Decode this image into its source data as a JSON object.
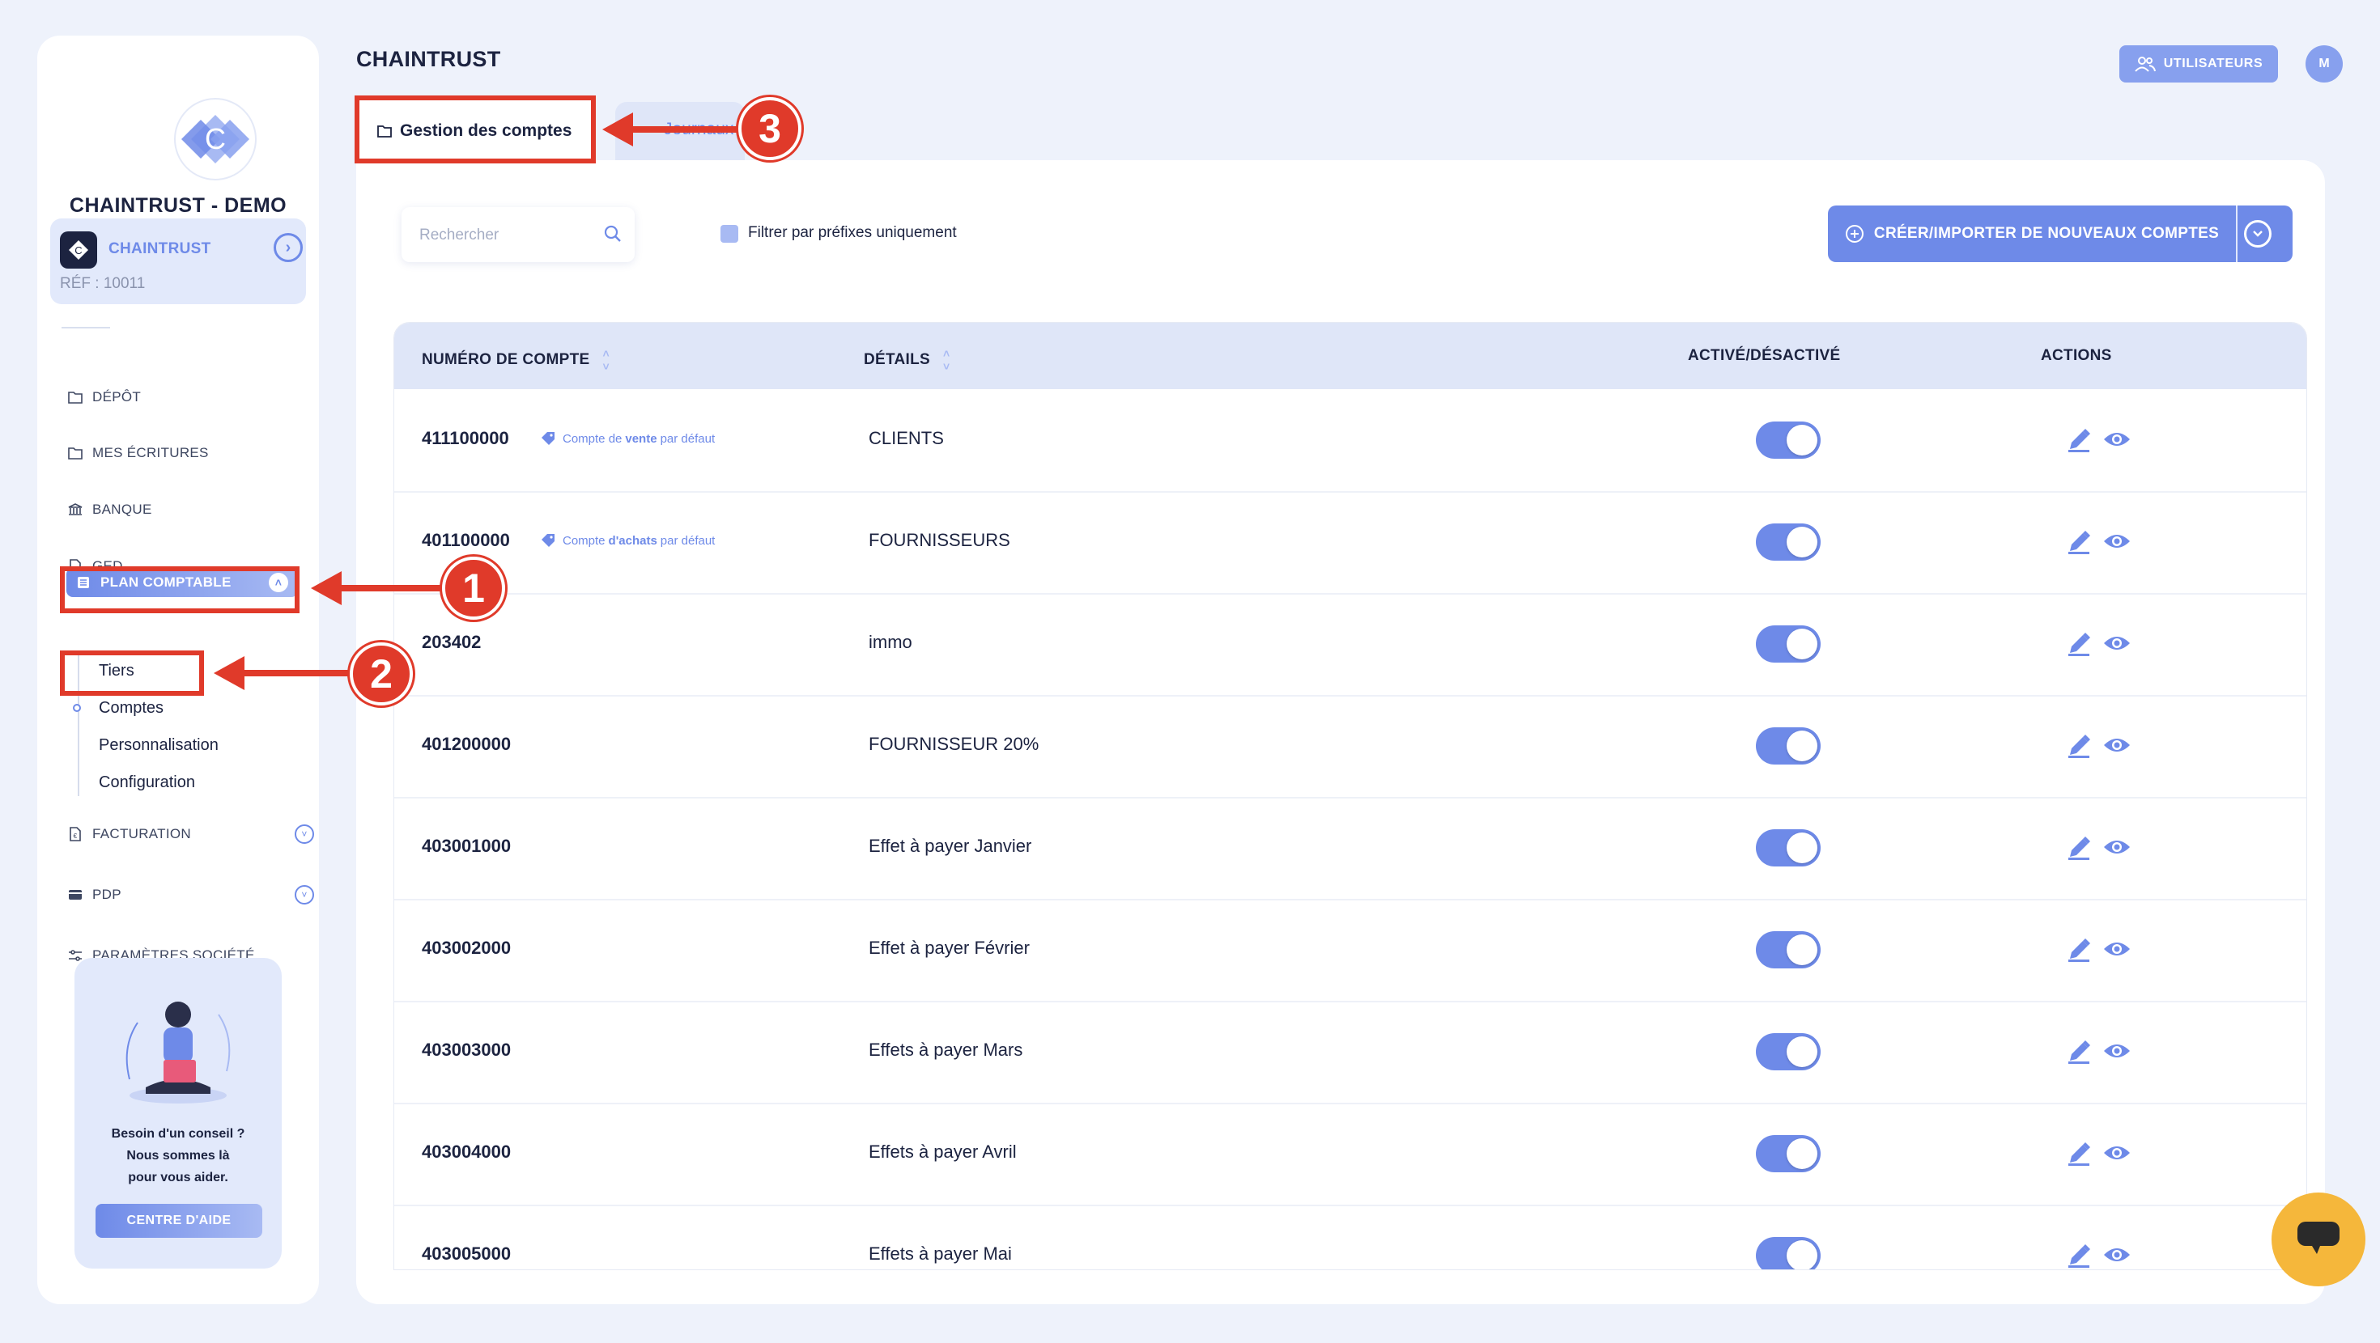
{
  "app": {
    "company": "CHAINTRUST - DEMO",
    "page_title": "CHAINTRUST"
  },
  "client": {
    "name": "CHAINTRUST",
    "ref": "RÉF : 10011"
  },
  "sidebar": {
    "items": [
      {
        "label": "DÉPÔT"
      },
      {
        "label": "MES ÉCRITURES"
      },
      {
        "label": "BANQUE"
      },
      {
        "label": "GED"
      }
    ],
    "active": {
      "label": "PLAN COMPTABLE"
    },
    "subitems": [
      {
        "label": "Tiers"
      },
      {
        "label": "Comptes"
      },
      {
        "label": "Personnalisation"
      },
      {
        "label": "Configuration"
      }
    ],
    "lower_items": [
      {
        "label": "FACTURATION"
      },
      {
        "label": "PDP"
      },
      {
        "label": "PARAMÈTRES SOCIÉTÉ"
      }
    ]
  },
  "help": {
    "line1": "Besoin d'un conseil ?",
    "line2": "Nous sommes là",
    "line3": "pour vous aider.",
    "button": "CENTRE D'AIDE"
  },
  "header": {
    "users_button": "UTILISATEURS",
    "avatar_initial": "M"
  },
  "tabs": [
    {
      "label": "Gestion des comptes"
    },
    {
      "label": "Journaux"
    }
  ],
  "toolbar": {
    "search_placeholder": "Rechercher",
    "filter_label": "Filtrer par préfixes uniquement",
    "create_button": "CRÉER/IMPORTER DE NOUVEAUX COMPTES"
  },
  "table": {
    "columns": [
      "NUMÉRO DE COMPTE",
      "DÉTAILS",
      "ACTIVÉ/DÉSACTIVÉ",
      "ACTIONS"
    ],
    "rows": [
      {
        "account": "411100000",
        "badge_pre": "Compte de",
        "badge_bold": "vente",
        "badge_post": "par défaut",
        "detail": "CLIENTS",
        "active": true
      },
      {
        "account": "401100000",
        "badge_pre": "Compte",
        "badge_bold": "d'achats",
        "badge_post": "par défaut",
        "detail": "FOURNISSEURS",
        "active": true
      },
      {
        "account": "203402",
        "detail": "immo",
        "active": true
      },
      {
        "account": "401200000",
        "detail": "FOURNISSEUR 20%",
        "active": true
      },
      {
        "account": "403001000",
        "detail": "Effet à payer Janvier",
        "active": true
      },
      {
        "account": "403002000",
        "detail": "Effet à payer Février",
        "active": true
      },
      {
        "account": "403003000",
        "detail": "Effets à payer Mars",
        "active": true
      },
      {
        "account": "403004000",
        "detail": "Effets à payer Avril",
        "active": true
      },
      {
        "account": "403005000",
        "detail": "Effets à payer Mai",
        "active": true
      }
    ]
  },
  "annotations": {
    "n1": "1",
    "n2": "2",
    "n3": "3"
  },
  "colors": {
    "accent": "#6e8ae8",
    "annotation": "#e03a2a",
    "background": "#eef2fb",
    "chat": "#f5b73b"
  }
}
